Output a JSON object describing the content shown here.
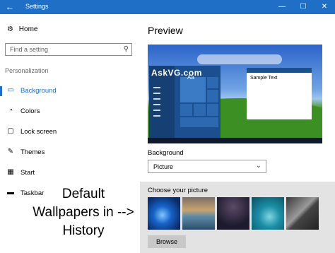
{
  "window": {
    "title": "Settings",
    "back_glyph": "←",
    "minimize_glyph": "—",
    "maximize_glyph": "☐",
    "close_glyph": "✕"
  },
  "sidebar": {
    "home": {
      "label": "Home",
      "icon": "gear-icon",
      "glyph": "⚙"
    },
    "search_placeholder": "Find a setting",
    "search_icon_glyph": "⚲",
    "section_heading": "Personalization",
    "items": [
      {
        "label": "Background",
        "icon": "picture-icon",
        "glyph": "▭",
        "active": true
      },
      {
        "label": "Colors",
        "icon": "palette-icon",
        "glyph": "◔",
        "active": false
      },
      {
        "label": "Lock screen",
        "icon": "lock-screen-icon",
        "glyph": "▢",
        "active": false
      },
      {
        "label": "Themes",
        "icon": "brush-icon",
        "glyph": "✎",
        "active": false
      },
      {
        "label": "Start",
        "icon": "start-icon",
        "glyph": "▦",
        "active": false
      },
      {
        "label": "Taskbar",
        "icon": "taskbar-icon",
        "glyph": "▬",
        "active": false
      }
    ]
  },
  "annotation": {
    "lines": [
      "Default",
      "Wallpapers in -->",
      "History"
    ]
  },
  "main": {
    "preview_title": "Preview",
    "preview": {
      "watermark": "AskVG.com",
      "tile_text": "Aa",
      "sample_text": "Sample Text"
    },
    "background_label": "Background",
    "background_select": {
      "value": "Picture",
      "chevron_glyph": "⌄"
    },
    "choose_label": "Choose your picture",
    "browse_label": "Browse"
  },
  "colors": {
    "accent": "#1f6fc6",
    "chooser_bg": "#e3e3e3"
  }
}
